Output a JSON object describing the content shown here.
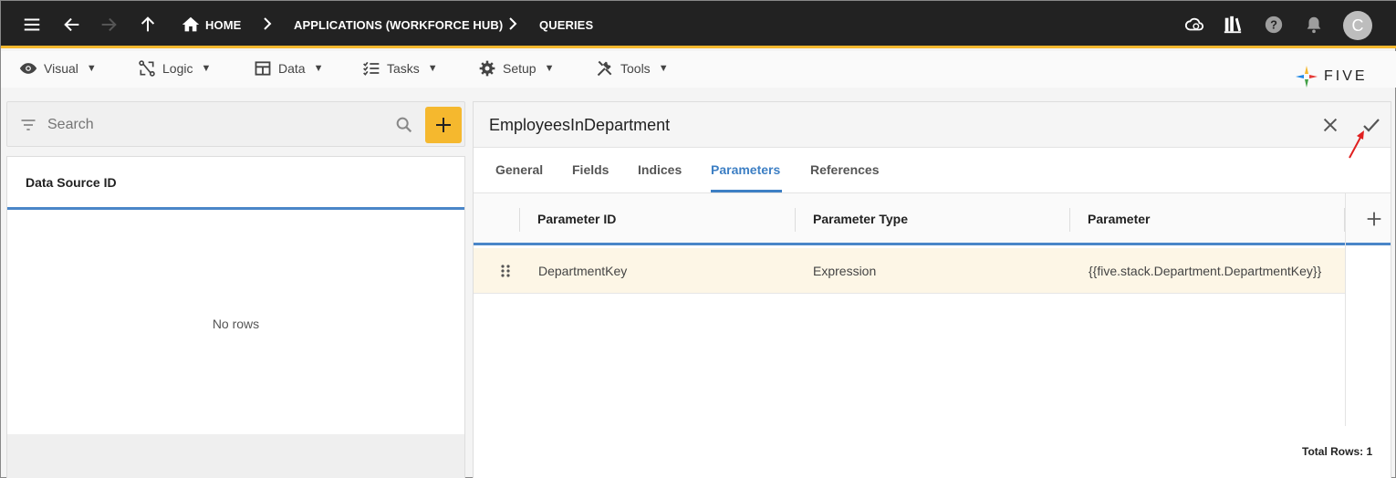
{
  "topbar": {
    "breadcrumbs": [
      "HOME",
      "APPLICATIONS (WORKFORCE HUB)",
      "QUERIES"
    ],
    "avatar_initial": "C"
  },
  "menu": {
    "items": [
      "Visual",
      "Logic",
      "Data",
      "Tasks",
      "Setup",
      "Tools"
    ],
    "caret": "▼"
  },
  "brand": {
    "logo_text": "FIVE",
    "accent": "#f5b82e"
  },
  "left": {
    "search_placeholder": "Search",
    "column_header": "Data Source ID",
    "empty_text": "No rows"
  },
  "form": {
    "title": "EmployeesInDepartment",
    "tabs": [
      "General",
      "Fields",
      "Indices",
      "Parameters",
      "References"
    ],
    "active_tab": "Parameters"
  },
  "grid": {
    "columns": [
      "Parameter ID",
      "Parameter Type",
      "Parameter"
    ],
    "rows": [
      [
        "DepartmentKey",
        "Expression",
        "{{five.stack.Department.DepartmentKey}}"
      ]
    ],
    "total_rows": "Total Rows: 1"
  }
}
